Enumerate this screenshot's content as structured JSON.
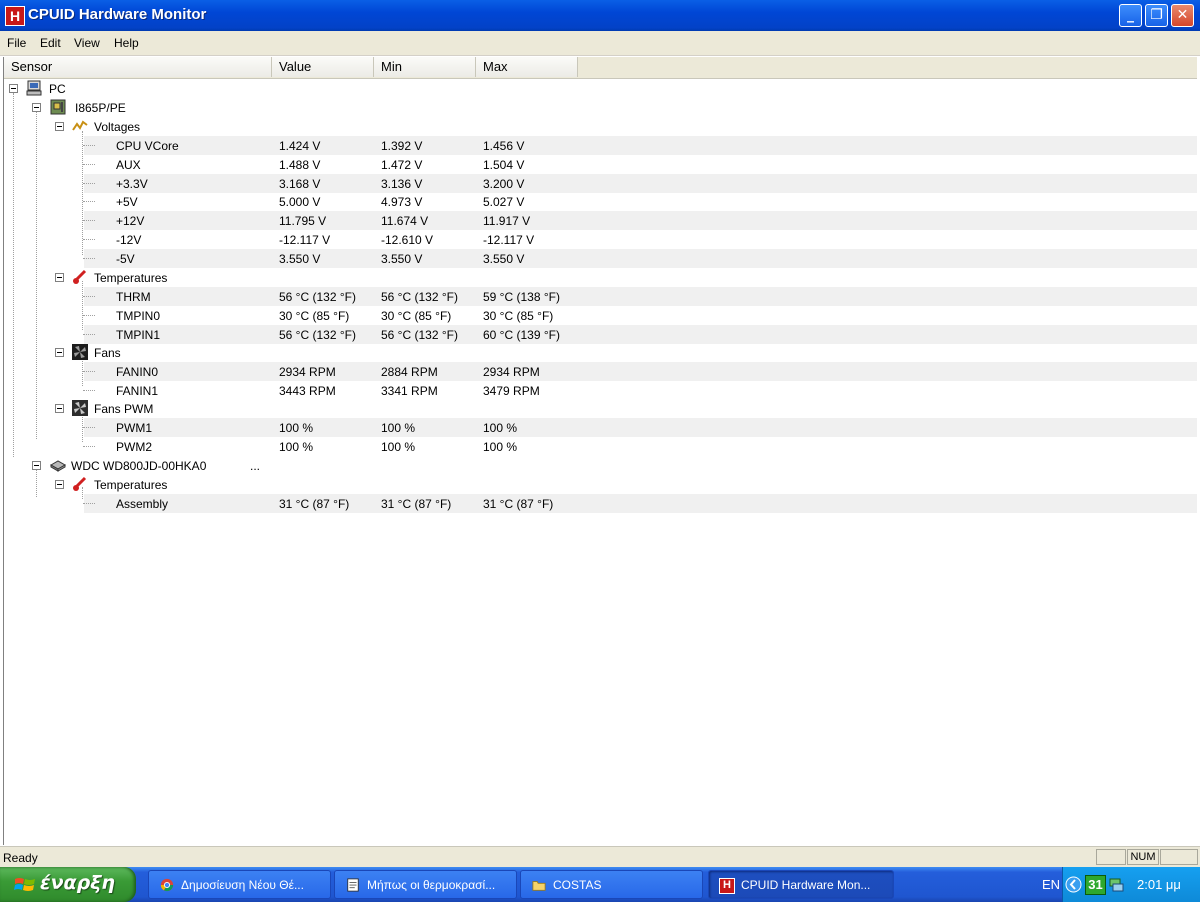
{
  "window": {
    "app_icon_letter": "H",
    "title": "CPUID Hardware Monitor",
    "minimize_glyph": "_",
    "maximize_glyph": "❐",
    "close_glyph": "✕"
  },
  "menu": [
    "File",
    "Edit",
    "View",
    "Help"
  ],
  "columns": [
    "Sensor",
    "Value",
    "Min",
    "Max"
  ],
  "tree": {
    "root": "PC",
    "board": "I865P/PE",
    "voltages_label": "Voltages",
    "voltages": [
      {
        "name": "CPU VCore",
        "value": "1.424 V",
        "min": "1.392 V",
        "max": "1.456 V"
      },
      {
        "name": "AUX",
        "value": "1.488 V",
        "min": "1.472 V",
        "max": "1.504 V"
      },
      {
        "name": "+3.3V",
        "value": "3.168 V",
        "min": "3.136 V",
        "max": "3.200 V"
      },
      {
        "name": "+5V",
        "value": "5.000 V",
        "min": "4.973 V",
        "max": "5.027 V"
      },
      {
        "name": "+12V",
        "value": "11.795 V",
        "min": "11.674 V",
        "max": "11.917 V"
      },
      {
        "name": "-12V",
        "value": "-12.117 V",
        "min": "-12.610 V",
        "max": "-12.117 V"
      },
      {
        "name": "-5V",
        "value": "3.550 V",
        "min": "3.550 V",
        "max": "3.550 V"
      }
    ],
    "temperatures_label": "Temperatures",
    "temperatures": [
      {
        "name": "THRM",
        "value": "56 °C  (132 °F)",
        "min": "56 °C  (132 °F)",
        "max": "59 °C  (138 °F)"
      },
      {
        "name": "TMPIN0",
        "value": "30 °C  (85 °F)",
        "min": "30 °C  (85 °F)",
        "max": "30 °C  (85 °F)"
      },
      {
        "name": "TMPIN1",
        "value": "56 °C  (132 °F)",
        "min": "56 °C  (132 °F)",
        "max": "60 °C  (139 °F)"
      }
    ],
    "fans_label": "Fans",
    "fans": [
      {
        "name": "FANIN0",
        "value": "2934 RPM",
        "min": "2884 RPM",
        "max": "2934 RPM"
      },
      {
        "name": "FANIN1",
        "value": "3443 RPM",
        "min": "3341 RPM",
        "max": "3479 RPM"
      }
    ],
    "fans_pwm_label": "Fans PWM",
    "fans_pwm": [
      {
        "name": "PWM1",
        "value": "100 %",
        "min": "100 %",
        "max": "100 %"
      },
      {
        "name": "PWM2",
        "value": "100 %",
        "min": "100 %",
        "max": "100 %"
      }
    ],
    "disk": "WDC WD800JD-00HKA0",
    "disk_ellipsis": "...",
    "disk_temperatures_label": "Temperatures",
    "disk_temperatures": [
      {
        "name": "Assembly",
        "value": "31 °C  (87 °F)",
        "min": "31 °C  (87 °F)",
        "max": "31 °C  (87 °F)"
      }
    ]
  },
  "status": {
    "text": "Ready",
    "num": "NUM"
  },
  "taskbar": {
    "start_label": "έναρξη",
    "tasks": [
      {
        "label": "Δημοσίευση Νέου Θέ...",
        "icon": "chrome-icon"
      },
      {
        "label": "Μήπως οι θερμοκρασί...",
        "icon": "document-icon"
      },
      {
        "label": "COSTAS",
        "icon": "folder-icon"
      },
      {
        "label": "CPUID Hardware Mon...",
        "icon": "cpuid-icon"
      }
    ],
    "tray_lang": "EN",
    "tray_badge": "31",
    "clock": "2:01 μμ"
  },
  "colors": {
    "titlebar": "#0046d5",
    "app_icon": "#c81818",
    "row_shade": "#f0f0f0",
    "taskbar": "#245edb",
    "start_button": "#3a9b36",
    "tray": "#0e8ad8"
  }
}
